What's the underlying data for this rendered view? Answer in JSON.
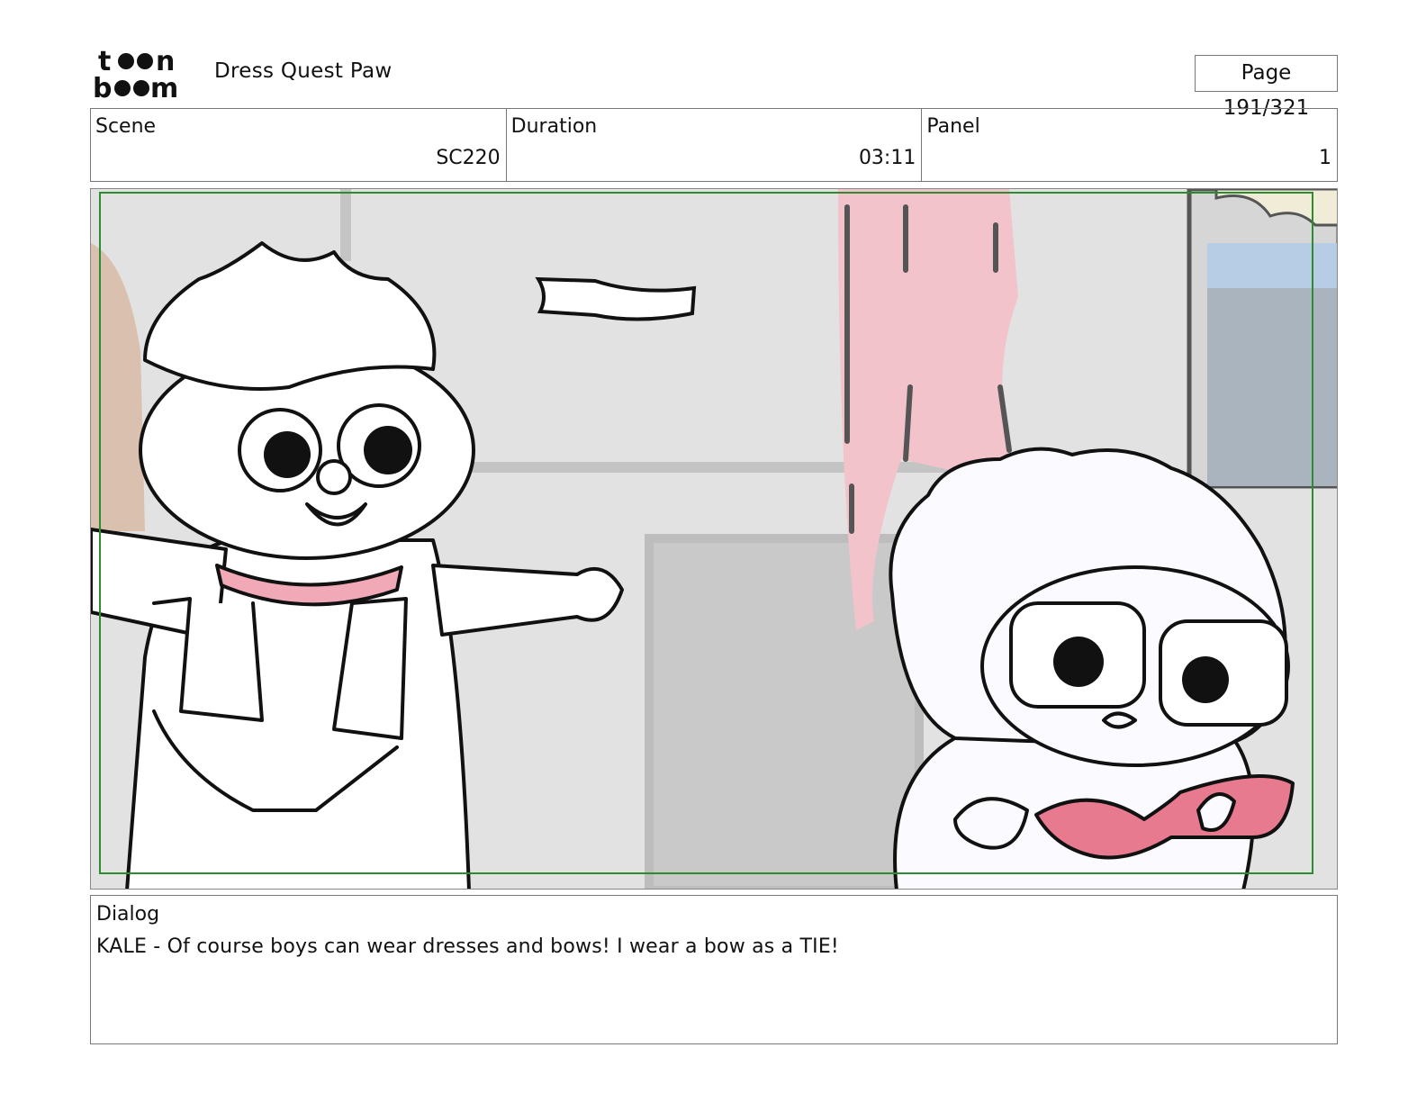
{
  "header": {
    "logo_text": "toon boom",
    "project_title": "Dress Quest Paw",
    "page_label": "Page 191/321"
  },
  "info": {
    "scene_label": "Scene",
    "scene_value": "SC220",
    "duration_label": "Duration",
    "duration_value": "03:11",
    "panel_label": "Panel",
    "panel_value": "1"
  },
  "dialog": {
    "label": "Dialog",
    "text": "KALE - Of course boys can wear dresses and bows! I wear a bow as a TIE!"
  },
  "colors": {
    "safe_frame": "#2e8b2e",
    "bow_pink": "#e77a8e",
    "curtain_pink": "#f3c3cc",
    "sky_blue": "#b7cde6"
  }
}
